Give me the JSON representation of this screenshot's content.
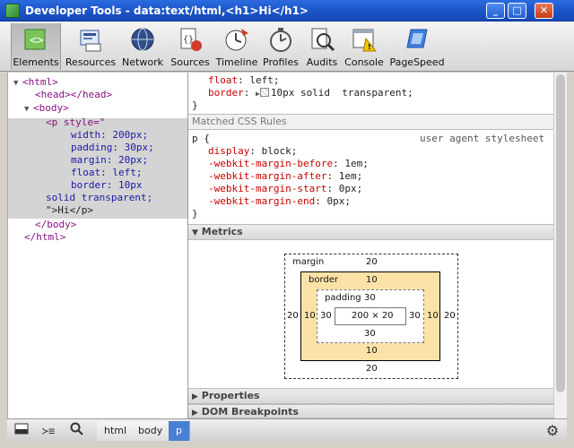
{
  "window": {
    "title": "Developer Tools - data:text/html,<h1>Hi</h1>",
    "minimize": "_",
    "maximize": "□",
    "close": "✕"
  },
  "toolbar": {
    "tabs": [
      {
        "label": "Elements",
        "icon": "elements-icon"
      },
      {
        "label": "Resources",
        "icon": "resources-icon"
      },
      {
        "label": "Network",
        "icon": "network-icon"
      },
      {
        "label": "Sources",
        "icon": "sources-icon"
      },
      {
        "label": "Timeline",
        "icon": "timeline-icon"
      },
      {
        "label": "Profiles",
        "icon": "profiles-icon"
      },
      {
        "label": "Audits",
        "icon": "audits-icon"
      },
      {
        "label": "Console",
        "icon": "console-icon"
      },
      {
        "label": "PageSpeed",
        "icon": "pagespeed-icon"
      }
    ],
    "active": "Elements"
  },
  "dom": {
    "lines": [
      {
        "t": "<html>"
      },
      {
        "t": "<head></head>"
      },
      {
        "t": "<body>"
      },
      {
        "t": "<p style=\""
      },
      {
        "t": "width: 200px;"
      },
      {
        "t": "padding: 30px;"
      },
      {
        "t": "margin: 20px;"
      },
      {
        "t": "float: left;"
      },
      {
        "t": "border: 10px"
      },
      {
        "t": "solid transparent;"
      },
      {
        "t": "\">Hi</p>"
      },
      {
        "t": "</body>"
      },
      {
        "t": "</html>"
      }
    ]
  },
  "styles": {
    "top_rules": [
      {
        "prop": "float",
        "value": "left;"
      },
      {
        "prop": "border",
        "value": "10px solid  transparent;"
      }
    ],
    "top_close": "}",
    "matched_header": "Matched CSS Rules",
    "rule_selector": "p {",
    "rule_origin": "user agent stylesheet",
    "rule_props": [
      {
        "prop": "display",
        "value": "block;"
      },
      {
        "prop": "-webkit-margin-before",
        "value": "1em;"
      },
      {
        "prop": "-webkit-margin-after",
        "value": "1em;"
      },
      {
        "prop": "-webkit-margin-start",
        "value": "0px;"
      },
      {
        "prop": "-webkit-margin-end",
        "value": "0px;"
      }
    ],
    "rule_close": "}"
  },
  "metrics": {
    "header": "Metrics",
    "margin_label": "margin",
    "margin": {
      "top": "20",
      "right": "20",
      "bottom": "20",
      "left": "20"
    },
    "border_label": "border",
    "border": {
      "top": "10",
      "right": "10",
      "bottom": "10",
      "left": "10"
    },
    "padding_label": "padding",
    "padding": {
      "top": "30",
      "right": "30",
      "bottom": "30",
      "left": "30"
    },
    "content": "200 × 20"
  },
  "sections": {
    "properties": "Properties",
    "dom_breakpoints": "DOM Breakpoints"
  },
  "statusbar": {
    "breadcrumbs": [
      "html",
      "body",
      "p"
    ],
    "active": "p"
  },
  "colors": {
    "titlebar": "#1c56c8",
    "selected_crumb": "#4a7fd6",
    "border_box": "#fbe3a8"
  }
}
